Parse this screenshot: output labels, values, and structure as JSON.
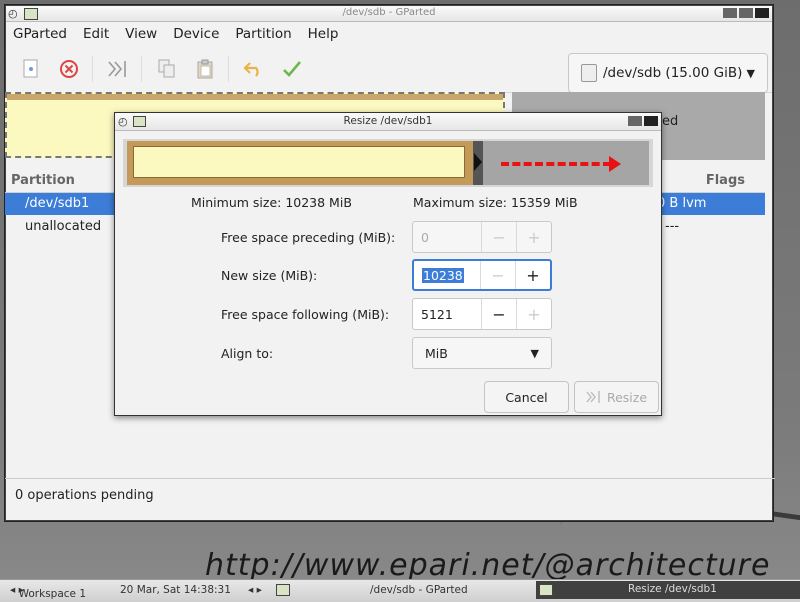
{
  "main_window": {
    "title": "/dev/sdb - GParted",
    "menu": [
      "GParted",
      "Edit",
      "View",
      "Device",
      "Partition",
      "Help"
    ],
    "device_selector": "/dev/sdb (15.00 GiB)",
    "map_label": "ed",
    "columns": {
      "partition": "Partition",
      "flags": "Flags"
    },
    "rows": [
      {
        "partition": "/dev/sdb1",
        "flags": "0 B  lvm"
      },
      {
        "partition": "unallocated",
        "flags": "---"
      }
    ],
    "status": "0 operations pending"
  },
  "dialog": {
    "title": "Resize /dev/sdb1",
    "min_size": "Minimum size: 10238 MiB",
    "max_size": "Maximum size: 15359 MiB",
    "labels": {
      "preceding": "Free space preceding (MiB):",
      "new_size": "New size (MiB):",
      "following": "Free space following (MiB):",
      "align": "Align to:"
    },
    "values": {
      "preceding": "0",
      "new_size": "10238",
      "following": "5121",
      "align": "MiB"
    },
    "buttons": {
      "cancel": "Cancel",
      "resize": "Resize"
    }
  },
  "taskbar": {
    "workspace": "Workspace 1",
    "datetime": "20 Mar, Sat 14:38:31",
    "task_main": "/dev/sdb - GParted",
    "task_dialog": "Resize /dev/sdb1"
  },
  "watermark": "http://www.epari.net/@architecture"
}
